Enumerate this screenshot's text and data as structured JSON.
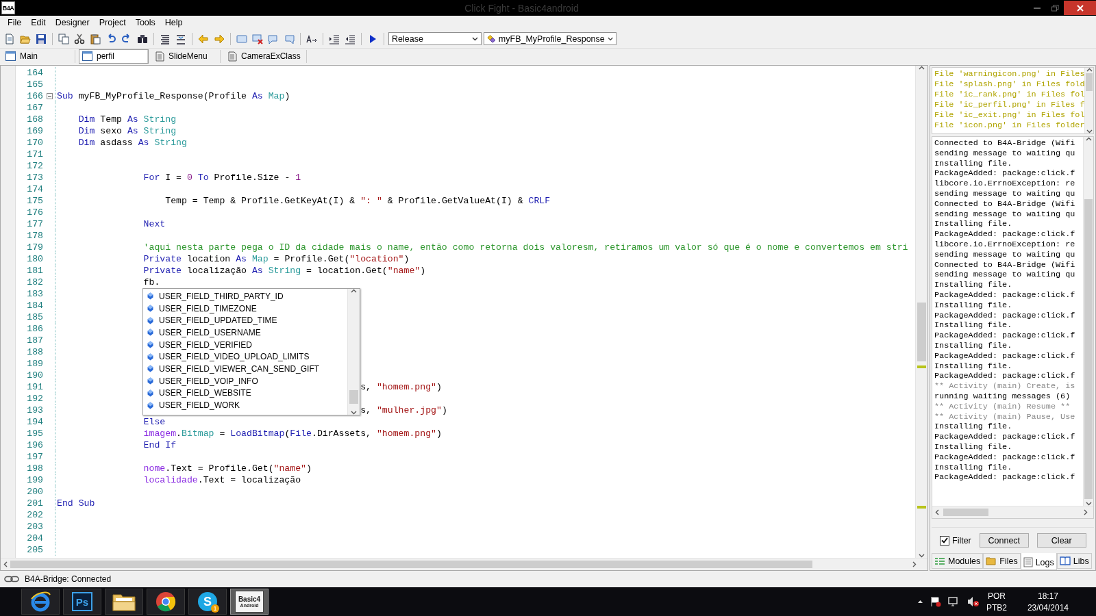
{
  "window": {
    "title": "Click Fight - Basic4android",
    "logo": "B4A"
  },
  "menu": [
    "File",
    "Edit",
    "Designer",
    "Project",
    "Tools",
    "Help"
  ],
  "toolbar": {
    "build_config": "Release",
    "sub_selector": "myFB_MyProfile_Response"
  },
  "module_tabs": [
    {
      "label": "Main",
      "kind": "form",
      "selected": false
    },
    {
      "label": "perfil",
      "kind": "form",
      "selected": true
    },
    {
      "label": "SlideMenu",
      "kind": "code",
      "selected": false
    },
    {
      "label": "CameraExClass",
      "kind": "code",
      "selected": false
    }
  ],
  "editor": {
    "lines": [
      {
        "number": "164",
        "kind": "blank"
      },
      {
        "number": "165",
        "kind": "blank"
      },
      {
        "number": "166",
        "kind": "top",
        "expanded": true,
        "tokens": [
          {
            "kind": "kw",
            "text": "Sub"
          },
          {
            "kind": "plain",
            "text": " myFB_MyProfile_Response(Profile "
          },
          {
            "kind": "kw",
            "text": "As"
          },
          {
            "kind": "type",
            "text": " Map"
          },
          {
            "kind": "plain",
            "text": ")"
          }
        ]
      },
      {
        "number": "167",
        "kind": "blank"
      },
      {
        "number": "168",
        "kind": "body",
        "tokens": [
          {
            "kind": "kw",
            "text": "Dim"
          },
          {
            "kind": "plain",
            "text": " Temp "
          },
          {
            "kind": "kw",
            "text": "As"
          },
          {
            "kind": "type",
            "text": " String"
          }
        ]
      },
      {
        "number": "169",
        "kind": "body",
        "tokens": [
          {
            "kind": "kw",
            "text": "Dim"
          },
          {
            "kind": "plain",
            "text": " sexo "
          },
          {
            "kind": "kw",
            "text": "As"
          },
          {
            "kind": "type",
            "text": " String"
          }
        ]
      },
      {
        "number": "170",
        "kind": "body",
        "tokens": [
          {
            "kind": "kw",
            "text": "Dim"
          },
          {
            "kind": "plain",
            "text": " asdass "
          },
          {
            "kind": "kw",
            "text": "As"
          },
          {
            "kind": "type",
            "text": " String"
          }
        ]
      },
      {
        "number": "171",
        "kind": "blank"
      },
      {
        "number": "172",
        "kind": "blank"
      },
      {
        "number": "173",
        "kind": "block",
        "tokens": [
          {
            "kind": "kw",
            "text": "For"
          },
          {
            "kind": "plain",
            "text": " I = "
          },
          {
            "kind": "num",
            "text": "0"
          },
          {
            "kind": "kw",
            "text": " To"
          },
          {
            "kind": "plain",
            "text": " Profile.Size - "
          },
          {
            "kind": "num",
            "text": "1"
          }
        ]
      },
      {
        "number": "174",
        "kind": "blank"
      },
      {
        "number": "175",
        "kind": "inner",
        "tokens": [
          {
            "kind": "plain",
            "text": "Temp = Temp & Profile.GetKeyAt(I) & "
          },
          {
            "kind": "str",
            "text": "\": \""
          },
          {
            "kind": "plain",
            "text": " & Profile.GetValueAt(I) & "
          },
          {
            "kind": "kw",
            "text": "CRLF"
          }
        ]
      },
      {
        "number": "176",
        "kind": "blank"
      },
      {
        "number": "177",
        "kind": "block",
        "tokens": [
          {
            "kind": "kw",
            "text": "Next"
          }
        ]
      },
      {
        "number": "178",
        "kind": "blank"
      },
      {
        "number": "179",
        "kind": "block",
        "tokens": [
          {
            "kind": "com",
            "text": "'aqui nesta parte pega o ID da cidade mais o name, então como retorna dois valoresm, retiramos um valor só que é o nome e convertemos em stri"
          }
        ]
      },
      {
        "number": "180",
        "kind": "block",
        "tokens": [
          {
            "kind": "kw",
            "text": "Private"
          },
          {
            "kind": "plain",
            "text": " location "
          },
          {
            "kind": "kw",
            "text": "As"
          },
          {
            "kind": "type",
            "text": " Map"
          },
          {
            "kind": "plain",
            "text": " = Profile.Get("
          },
          {
            "kind": "str",
            "text": "\"location\""
          },
          {
            "kind": "plain",
            "text": ")"
          }
        ]
      },
      {
        "number": "181",
        "kind": "block",
        "tokens": [
          {
            "kind": "kw",
            "text": "Private"
          },
          {
            "kind": "plain",
            "text": " localização "
          },
          {
            "kind": "kw",
            "text": "As"
          },
          {
            "kind": "type",
            "text": " String"
          },
          {
            "kind": "plain",
            "text": " = location.Get("
          },
          {
            "kind": "str",
            "text": "\"name\""
          },
          {
            "kind": "plain",
            "text": ")"
          }
        ]
      },
      {
        "number": "182",
        "kind": "block",
        "tokens": [
          {
            "kind": "plain",
            "text": "fb."
          }
        ]
      },
      {
        "number": "183",
        "kind": "blank"
      },
      {
        "number": "184",
        "kind": "blank"
      },
      {
        "number": "185",
        "kind": "blank"
      },
      {
        "number": "186",
        "kind": "blank"
      },
      {
        "number": "187",
        "kind": "blank"
      },
      {
        "number": "188",
        "kind": "blank"
      },
      {
        "number": "189",
        "kind": "blank"
      },
      {
        "number": "190",
        "kind": "blank"
      },
      {
        "number": "191",
        "kind": "covered",
        "tokens": [
          {
            "kind": "plain",
            "text": "s, "
          },
          {
            "kind": "str",
            "text": "\"homem.png\""
          },
          {
            "kind": "plain",
            "text": ")"
          }
        ]
      },
      {
        "number": "192",
        "kind": "blank"
      },
      {
        "number": "193",
        "kind": "covered",
        "tokens": [
          {
            "kind": "plain",
            "text": "s, "
          },
          {
            "kind": "str",
            "text": "\"mulher.jpg\""
          },
          {
            "kind": "plain",
            "text": ")"
          }
        ]
      },
      {
        "number": "194",
        "kind": "block",
        "tokens": [
          {
            "kind": "kw",
            "text": "Else"
          }
        ]
      },
      {
        "number": "195",
        "kind": "block",
        "tokens": [
          {
            "kind": "var",
            "text": "imagem"
          },
          {
            "kind": "plain",
            "text": "."
          },
          {
            "kind": "type",
            "text": "Bitmap"
          },
          {
            "kind": "plain",
            "text": " = "
          },
          {
            "kind": "kw",
            "text": "LoadBitmap"
          },
          {
            "kind": "plain",
            "text": "("
          },
          {
            "kind": "kw",
            "text": "File"
          },
          {
            "kind": "plain",
            "text": ".DirAssets, "
          },
          {
            "kind": "str",
            "text": "\"homem.png\""
          },
          {
            "kind": "plain",
            "text": ")"
          }
        ]
      },
      {
        "number": "196",
        "kind": "block",
        "tokens": [
          {
            "kind": "kw",
            "text": "End If"
          }
        ]
      },
      {
        "number": "197",
        "kind": "blank"
      },
      {
        "number": "198",
        "kind": "block",
        "tokens": [
          {
            "kind": "var",
            "text": "nome"
          },
          {
            "kind": "plain",
            "text": ".Text = Profile.Get("
          },
          {
            "kind": "str",
            "text": "\"name\""
          },
          {
            "kind": "plain",
            "text": ")"
          }
        ]
      },
      {
        "number": "199",
        "kind": "block",
        "tokens": [
          {
            "kind": "var",
            "text": "localidade"
          },
          {
            "kind": "plain",
            "text": ".Text = localização"
          }
        ]
      },
      {
        "number": "200",
        "kind": "blank"
      },
      {
        "number": "201",
        "kind": "top",
        "tokens": [
          {
            "kind": "kw",
            "text": "End Sub"
          }
        ]
      },
      {
        "number": "202",
        "kind": "blank"
      },
      {
        "number": "203",
        "kind": "blank"
      },
      {
        "number": "204",
        "kind": "blank"
      },
      {
        "number": "205",
        "kind": "blank"
      }
    ],
    "autocomplete": [
      "USER_FIELD_THIRD_PARTY_ID",
      "USER_FIELD_TIMEZONE",
      "USER_FIELD_UPDATED_TIME",
      "USER_FIELD_USERNAME",
      "USER_FIELD_VERIFIED",
      "USER_FIELD_VIDEO_UPLOAD_LIMITS",
      "USER_FIELD_VIEWER_CAN_SEND_GIFT",
      "USER_FIELD_VOIP_INFO",
      "USER_FIELD_WEBSITE",
      "USER_FIELD_WORK"
    ]
  },
  "file_warnings": [
    "File 'warningicon.png' in Files",
    "File 'splash.png' in Files fold",
    "File 'ic_rank.png' in Files fol",
    "File 'ic_perfil.png' in Files f",
    "File 'ic_exit.png' in Files fol",
    "File 'icon.png' in Files folder"
  ],
  "logs": [
    {
      "kind": "info",
      "text": "Connected to B4A-Bridge (Wifi"
    },
    {
      "kind": "info",
      "text": "sending message to waiting qu"
    },
    {
      "kind": "info",
      "text": "Installing file."
    },
    {
      "kind": "info",
      "text": "PackageAdded: package:click.f"
    },
    {
      "kind": "info",
      "text": "libcore.io.ErrnoException: re"
    },
    {
      "kind": "info",
      "text": "sending message to waiting qu"
    },
    {
      "kind": "info",
      "text": "Connected to B4A-Bridge (Wifi"
    },
    {
      "kind": "info",
      "text": "sending message to waiting qu"
    },
    {
      "kind": "info",
      "text": "Installing file."
    },
    {
      "kind": "info",
      "text": "PackageAdded: package:click.f"
    },
    {
      "kind": "info",
      "text": "libcore.io.ErrnoException: re"
    },
    {
      "kind": "info",
      "text": "sending message to waiting qu"
    },
    {
      "kind": "info",
      "text": "Connected to B4A-Bridge (Wifi"
    },
    {
      "kind": "info",
      "text": "sending message to waiting qu"
    },
    {
      "kind": "info",
      "text": "Installing file."
    },
    {
      "kind": "info",
      "text": "PackageAdded: package:click.f"
    },
    {
      "kind": "info",
      "text": "Installing file."
    },
    {
      "kind": "info",
      "text": "PackageAdded: package:click.f"
    },
    {
      "kind": "info",
      "text": "Installing file."
    },
    {
      "kind": "info",
      "text": "PackageAdded: package:click.f"
    },
    {
      "kind": "info",
      "text": "Installing file."
    },
    {
      "kind": "info",
      "text": "PackageAdded: package:click.f"
    },
    {
      "kind": "info",
      "text": "Installing file."
    },
    {
      "kind": "info",
      "text": "PackageAdded: package:click.f"
    },
    {
      "kind": "activity",
      "text": "** Activity (main) Create, is"
    },
    {
      "kind": "info",
      "text": "running waiting messages (6)"
    },
    {
      "kind": "activity",
      "text": "** Activity (main) Resume **"
    },
    {
      "kind": "activity",
      "text": "** Activity (main) Pause, Use"
    },
    {
      "kind": "info",
      "text": "Installing file."
    },
    {
      "kind": "info",
      "text": "PackageAdded: package:click.f"
    },
    {
      "kind": "info",
      "text": "Installing file."
    },
    {
      "kind": "info",
      "text": "PackageAdded: package:click.f"
    },
    {
      "kind": "info",
      "text": "Installing file."
    },
    {
      "kind": "info",
      "text": "PackageAdded: package:click.f"
    }
  ],
  "log_controls": {
    "filter": {
      "label": "Filter",
      "checked": true
    },
    "buttons": [
      "Connect",
      "Clear"
    ]
  },
  "panel_tabs": [
    {
      "label": "Modules",
      "kind": "modules",
      "selected": false
    },
    {
      "label": "Files",
      "kind": "files",
      "selected": false
    },
    {
      "label": "Logs",
      "kind": "logs",
      "selected": true
    },
    {
      "label": "Libs",
      "kind": "libs",
      "selected": false
    }
  ],
  "status_bar": {
    "text": "B4A-Bridge: Connected"
  },
  "taskbar": {
    "apps": [
      {
        "kind": "browser",
        "selected": false
      },
      {
        "kind": "photoshop",
        "label": "Ps",
        "selected": false
      },
      {
        "kind": "explorer",
        "selected": false
      },
      {
        "kind": "chrome",
        "selected": false
      },
      {
        "kind": "skype",
        "label": "S",
        "badge": "1",
        "selected": false
      },
      {
        "kind": "basic4android",
        "label": "Basic4",
        "sublabel": "Android",
        "selected": true
      }
    ],
    "tray": {
      "language": "POR",
      "layout": "PTB2",
      "time": "18:17",
      "date": "23/04/2014"
    }
  }
}
